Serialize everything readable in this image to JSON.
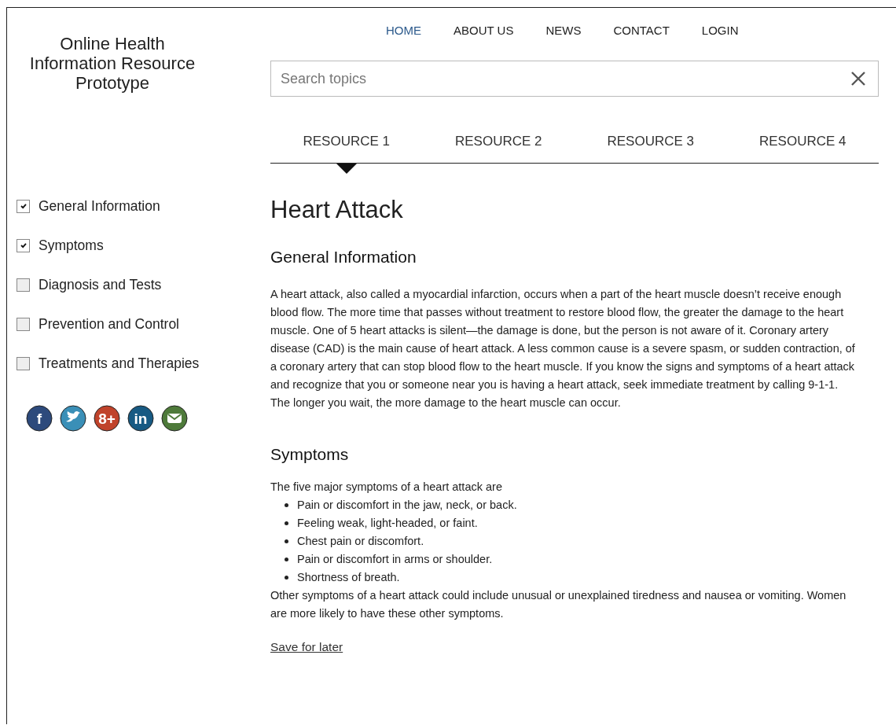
{
  "site_title": "Online Health Information Resource Prototype",
  "nav": [
    {
      "label": "HOME",
      "selected": true
    },
    {
      "label": "ABOUT US",
      "selected": false
    },
    {
      "label": "NEWS",
      "selected": false
    },
    {
      "label": "CONTACT",
      "selected": false
    },
    {
      "label": "LOGIN",
      "selected": false
    }
  ],
  "search": {
    "placeholder": "Search topics"
  },
  "tabs": [
    {
      "label": "RESOURCE 1",
      "selected": true
    },
    {
      "label": "RESOURCE 2",
      "selected": false
    },
    {
      "label": "RESOURCE 3",
      "selected": false
    },
    {
      "label": "RESOURCE 4",
      "selected": false
    }
  ],
  "filters": [
    {
      "label": "General Information",
      "checked": true
    },
    {
      "label": "Symptoms",
      "checked": true
    },
    {
      "label": "Diagnosis and Tests",
      "checked": false
    },
    {
      "label": "Prevention and Control",
      "checked": false
    },
    {
      "label": "Treatments and Therapies",
      "checked": false
    }
  ],
  "social": [
    {
      "kind": "facebook",
      "label": "f"
    },
    {
      "kind": "twitter"
    },
    {
      "kind": "googleplus",
      "label": "8+"
    },
    {
      "kind": "linkedin",
      "label": "in"
    },
    {
      "kind": "email"
    }
  ],
  "article": {
    "title": "Heart Attack",
    "sections": [
      {
        "heading": "General Information",
        "paragraphs": [
          "A heart attack, also called a myocardial infarction, occurs when a part of the heart muscle doesn’t receive enough blood flow. The more time that passes without treatment to restore blood flow, the greater the damage to the heart muscle. One of 5 heart attacks is silent—the damage is done, but the person is not aware of it. Coronary artery disease (CAD) is the main cause of heart attack. A less common cause is a severe spasm, or sudden contraction, of a coronary artery that can stop blood flow to the heart muscle. If you know the signs and symptoms of a heart attack and recognize that you or someone near you is having a heart attack, seek immediate treatment by calling 9-1-1. The longer you wait, the more damage to the heart muscle can occur."
        ]
      },
      {
        "heading": "Symptoms",
        "intro": "The five major symptoms of a heart attack are",
        "bullets": [
          "Pain or discomfort in the jaw, neck, or back.",
          "Feeling weak, light-headed, or faint.",
          "Chest pain or discomfort.",
          "Pain or discomfort in arms or shoulder.",
          "Shortness of breath."
        ],
        "paragraphs": [
          "Other symptoms of a heart attack could include unusual or unexplained tiredness and nausea or vomiting. Women are more likely to have these other symptoms."
        ]
      }
    ],
    "link": "Save for later"
  }
}
